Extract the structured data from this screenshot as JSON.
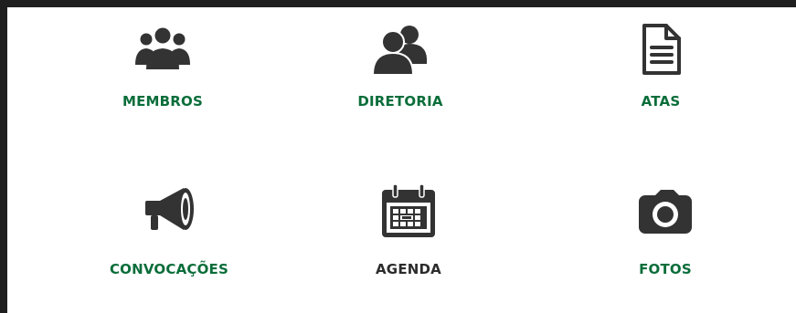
{
  "tiles": [
    {
      "label": "MEMBROS",
      "icon": "group-icon",
      "color": "#0a6d3a"
    },
    {
      "label": "DIRETORIA",
      "icon": "users-icon",
      "color": "#0a6d3a"
    },
    {
      "label": "ATAS",
      "icon": "document-icon",
      "color": "#0a6d3a"
    },
    {
      "label": "CONVOCAÇÕES",
      "icon": "megaphone-icon",
      "color": "#0a6d3a"
    },
    {
      "label": "AGENDA",
      "icon": "calendar-icon",
      "color": "#2b2b2b"
    },
    {
      "label": "FOTOS",
      "icon": "camera-icon",
      "color": "#0a6d3a"
    }
  ],
  "colors": {
    "accent": "#0a6d3a",
    "icon": "#333333",
    "frame": "#1f1f1f",
    "background": "#ffffff"
  }
}
